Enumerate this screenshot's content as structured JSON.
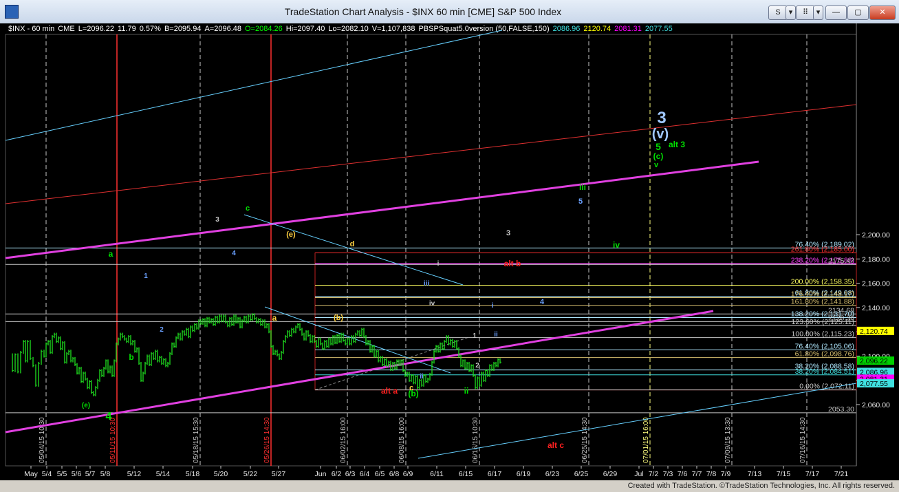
{
  "window": {
    "title": "TradeStation Chart Analysis - $INX 60 min [CME] S&P 500 Index",
    "buttons": [
      "S",
      "▾",
      "⠿",
      "▾",
      "—",
      "▢",
      "✕"
    ]
  },
  "header_line": {
    "items": [
      {
        "text": "$INX - 60 min",
        "color": "#ffffff"
      },
      {
        "text": "CME",
        "color": "#ffffff"
      },
      {
        "text": "L=2096.22",
        "color": "#ffffff"
      },
      {
        "text": "11.79",
        "color": "#ffffff"
      },
      {
        "text": "0.57%",
        "color": "#ffffff"
      },
      {
        "text": "B=2095.94",
        "color": "#ffffff"
      },
      {
        "text": "A=2096.48",
        "color": "#ffffff"
      },
      {
        "text": "O=2084.26",
        "color": "#00ff00"
      },
      {
        "text": "Hi=2097.40",
        "color": "#ffffff"
      },
      {
        "text": "Lo=2082.10",
        "color": "#ffffff"
      },
      {
        "text": "V=1,107,838",
        "color": "#ffffff"
      },
      {
        "text": "PBSPSquat5.0version (50,FALSE,150)",
        "color": "#ffffff"
      },
      {
        "text": "2086.96",
        "color": "#40e0e0"
      },
      {
        "text": "2120.74",
        "color": "#ffff00"
      },
      {
        "text": "2081.31",
        "color": "#ff00ff"
      },
      {
        "text": "2077.55",
        "color": "#40e0e0"
      }
    ]
  },
  "credit": "Created with TradeStation. ©TradeStation Technologies, Inc. All rights reserved.",
  "chart_data": {
    "type": "line",
    "instrument": "$INX 60 min",
    "ylim": [
      2047,
      2206
    ],
    "price_ticks": [
      "2,060.00",
      "2,080.00",
      "2,100.00",
      "2,120.00",
      "2,140.00",
      "2,160.00",
      "2,180.00",
      "2,200.00"
    ],
    "date_ticks": [
      "May",
      "5/4",
      "5/5",
      "5/6",
      "5/7",
      "5/8",
      "5/12",
      "5/14",
      "5/18",
      "5/20",
      "5/22",
      "5/27",
      "Jun",
      "6/2",
      "6/3",
      "6/4",
      "6/5",
      "6/8",
      "6/9",
      "6/11",
      "6/15",
      "6/17",
      "6/19",
      "6/23",
      "6/25",
      "6/29",
      "Jul",
      "7/2",
      "7/3",
      "7/6",
      "7/7",
      "7/8",
      "7/9",
      "7/13",
      "7/15",
      "7/17",
      "7/21"
    ],
    "vertical_date_labels": [
      {
        "text": "05/04/15 10:30",
        "color": "#c8c8c8"
      },
      {
        "text": "05/11/15 10:30",
        "color": "#ff3030"
      },
      {
        "text": "05/18/15 15:30",
        "color": "#c8c8c8"
      },
      {
        "text": "05/26/15 14:30",
        "color": "#ff3030"
      },
      {
        "text": "06/02/15 16:00",
        "color": "#c8c8c8"
      },
      {
        "text": "06/08/15 16:00",
        "color": "#c8c8c8"
      },
      {
        "text": "06/16/15 10:30",
        "color": "#c8c8c8"
      },
      {
        "text": "06/25/15 14:30",
        "color": "#c8c8c8"
      },
      {
        "text": "07/01/15 16:00",
        "color": "#ffff80"
      },
      {
        "text": "07/09/15 13:30",
        "color": "#c8c8c8"
      },
      {
        "text": "07/16/15 14:30",
        "color": "#c8c8c8"
      }
    ],
    "price_series": [
      [
        0,
        2101
      ],
      [
        6,
        2088
      ],
      [
        10,
        2101
      ],
      [
        14,
        2087
      ],
      [
        18,
        2103
      ],
      [
        22,
        2112
      ],
      [
        25,
        2096
      ],
      [
        28,
        2112
      ],
      [
        32,
        2098
      ],
      [
        36,
        2092
      ],
      [
        40,
        2076
      ],
      [
        44,
        2094
      ],
      [
        48,
        2104
      ],
      [
        52,
        2100
      ],
      [
        55,
        2110
      ],
      [
        58,
        2112
      ],
      [
        61,
        2103
      ],
      [
        64,
        2116
      ],
      [
        67,
        2118
      ],
      [
        70,
        2112
      ],
      [
        73,
        2115
      ],
      [
        76,
        2106
      ],
      [
        79,
        2111
      ],
      [
        82,
        2095
      ],
      [
        85,
        2102
      ],
      [
        88,
        2104
      ],
      [
        91,
        2096
      ],
      [
        94,
        2098
      ],
      [
        97,
        2093
      ],
      [
        100,
        2086
      ],
      [
        103,
        2090
      ],
      [
        106,
        2079
      ],
      [
        109,
        2086
      ],
      [
        112,
        2081
      ],
      [
        115,
        2074
      ],
      [
        118,
        2079
      ],
      [
        121,
        2070
      ],
      [
        124,
        2068
      ],
      [
        127,
        2074
      ],
      [
        130,
        2080
      ],
      [
        133,
        2088
      ],
      [
        136,
        2084
      ],
      [
        139,
        2090
      ],
      [
        142,
        2096
      ],
      [
        145,
        2087
      ],
      [
        148,
        2091
      ],
      [
        151,
        2084
      ],
      [
        154,
        2096
      ],
      [
        157,
        2110
      ],
      [
        160,
        2114
      ],
      [
        163,
        2118
      ],
      [
        166,
        2116
      ],
      [
        169,
        2114
      ],
      [
        172,
        2112
      ],
      [
        175,
        2116
      ],
      [
        178,
        2110
      ],
      [
        181,
        2112
      ],
      [
        184,
        2104
      ],
      [
        187,
        2106
      ],
      [
        190,
        2094
      ],
      [
        193,
        2080
      ],
      [
        196,
        2086
      ],
      [
        199,
        2094
      ],
      [
        202,
        2100
      ],
      [
        205,
        2093
      ],
      [
        208,
        2102
      ],
      [
        211,
        2098
      ],
      [
        214,
        2104
      ],
      [
        217,
        2096
      ],
      [
        220,
        2099
      ],
      [
        223,
        2094
      ],
      [
        226,
        2097
      ],
      [
        229,
        2092
      ],
      [
        232,
        2094
      ],
      [
        235,
        2102
      ],
      [
        238,
        2110
      ],
      [
        241,
        2108
      ],
      [
        244,
        2115
      ],
      [
        247,
        2118
      ],
      [
        250,
        2114
      ],
      [
        253,
        2120
      ],
      [
        256,
        2118
      ],
      [
        259,
        2122
      ],
      [
        262,
        2116
      ],
      [
        265,
        2124
      ],
      [
        268,
        2121
      ],
      [
        271,
        2126
      ],
      [
        274,
        2123
      ],
      [
        277,
        2129
      ],
      [
        280,
        2127
      ],
      [
        283,
        2130
      ],
      [
        286,
        2125
      ],
      [
        289,
        2131
      ],
      [
        292,
        2128
      ],
      [
        295,
        2130
      ],
      [
        298,
        2126
      ],
      [
        301,
        2132
      ],
      [
        304,
        2128
      ],
      [
        307,
        2133
      ],
      [
        310,
        2129
      ],
      [
        313,
        2133
      ],
      [
        316,
        2128
      ],
      [
        319,
        2125
      ],
      [
        322,
        2131
      ],
      [
        325,
        2126
      ],
      [
        328,
        2133
      ],
      [
        331,
        2128
      ],
      [
        334,
        2131
      ],
      [
        337,
        2124
      ],
      [
        340,
        2129
      ],
      [
        343,
        2132
      ],
      [
        346,
        2128
      ],
      [
        349,
        2133
      ],
      [
        352,
        2130
      ],
      [
        355,
        2134
      ],
      [
        358,
        2131
      ],
      [
        361,
        2128
      ],
      [
        364,
        2130
      ],
      [
        367,
        2126
      ],
      [
        370,
        2129
      ],
      [
        373,
        2124
      ],
      [
        376,
        2126
      ],
      [
        379,
        2120
      ],
      [
        382,
        2108
      ],
      [
        385,
        2102
      ],
      [
        388,
        2104
      ],
      [
        391,
        2101
      ],
      [
        394,
        2098
      ],
      [
        397,
        2103
      ],
      [
        400,
        2112
      ],
      [
        403,
        2116
      ],
      [
        406,
        2120
      ],
      [
        409,
        2117
      ],
      [
        412,
        2122
      ],
      [
        415,
        2120
      ],
      [
        418,
        2124
      ],
      [
        421,
        2126
      ],
      [
        424,
        2122
      ],
      [
        427,
        2118
      ],
      [
        430,
        2114
      ],
      [
        433,
        2120
      ],
      [
        436,
        2117
      ],
      [
        439,
        2112
      ],
      [
        442,
        2116
      ],
      [
        445,
        2112
      ],
      [
        448,
        2108
      ],
      [
        451,
        2114
      ],
      [
        454,
        2110
      ],
      [
        457,
        2106
      ],
      [
        460,
        2112
      ],
      [
        463,
        2108
      ],
      [
        466,
        2114
      ],
      [
        469,
        2110
      ],
      [
        472,
        2116
      ],
      [
        475,
        2111
      ],
      [
        478,
        2117
      ],
      [
        481,
        2112
      ],
      [
        484,
        2118
      ],
      [
        487,
        2113
      ],
      [
        490,
        2110
      ],
      [
        493,
        2114
      ],
      [
        496,
        2110
      ],
      [
        499,
        2116
      ],
      [
        502,
        2112
      ],
      [
        505,
        2118
      ],
      [
        508,
        2120
      ],
      [
        511,
        2117
      ],
      [
        514,
        2122
      ],
      [
        517,
        2116
      ],
      [
        520,
        2110
      ],
      [
        523,
        2112
      ],
      [
        526,
        2104
      ],
      [
        529,
        2108
      ],
      [
        532,
        2100
      ],
      [
        535,
        2104
      ],
      [
        538,
        2096
      ],
      [
        541,
        2099
      ],
      [
        544,
        2093
      ],
      [
        547,
        2097
      ],
      [
        550,
        2092
      ],
      [
        553,
        2095
      ],
      [
        556,
        2089
      ],
      [
        559,
        2094
      ],
      [
        562,
        2090
      ],
      [
        565,
        2096
      ],
      [
        568,
        2093
      ],
      [
        571,
        2096
      ],
      [
        574,
        2088
      ],
      [
        577,
        2084
      ],
      [
        580,
        2086
      ],
      [
        583,
        2080
      ],
      [
        586,
        2084
      ],
      [
        589,
        2078
      ],
      [
        592,
        2083
      ],
      [
        595,
        2074
      ],
      [
        598,
        2080
      ],
      [
        601,
        2076
      ],
      [
        604,
        2084
      ],
      [
        607,
        2079
      ],
      [
        610,
        2081
      ],
      [
        613,
        2085
      ],
      [
        616,
        2095
      ],
      [
        619,
        2104
      ],
      [
        622,
        2108
      ],
      [
        625,
        2104
      ],
      [
        628,
        2110
      ],
      [
        631,
        2106
      ],
      [
        634,
        2112
      ],
      [
        637,
        2116
      ],
      [
        640,
        2110
      ],
      [
        643,
        2113
      ],
      [
        646,
        2108
      ],
      [
        649,
        2112
      ],
      [
        652,
        2106
      ],
      [
        655,
        2100
      ],
      [
        658,
        2092
      ],
      [
        661,
        2096
      ],
      [
        664,
        2090
      ],
      [
        667,
        2094
      ],
      [
        670,
        2088
      ],
      [
        673,
        2092
      ],
      [
        676,
        2084
      ],
      [
        679,
        2074
      ],
      [
        682,
        2082
      ],
      [
        685,
        2076
      ],
      [
        688,
        2086
      ],
      [
        691,
        2080
      ],
      [
        694,
        2088
      ],
      [
        697,
        2084
      ],
      [
        700,
        2092
      ],
      [
        703,
        2089
      ],
      [
        706,
        2094
      ],
      [
        709,
        2092
      ],
      [
        712,
        2097
      ],
      [
        715,
        2095
      ]
    ],
    "horizontal_levels": [
      {
        "label": "76.40% (2,189.02)",
        "price": 2189.02,
        "color": "#b0e8ff"
      },
      {
        "label": "261.80% (2,185.00)",
        "price": 2185.0,
        "color": "#ff3030"
      },
      {
        "label": "238.20% (2,175.88)",
        "price": 2175.88,
        "color": "#ff40ff"
      },
      {
        "label": "2175.47",
        "price": 2175.47,
        "color": "#c8c8c8"
      },
      {
        "label": "200.00% (2,158.35)",
        "price": 2158.35,
        "color": "#ffff60"
      },
      {
        "label": "61.80% (2,149.08)",
        "price": 2149.08,
        "color": "#b0e8ff"
      },
      {
        "label": "176.40% (2,148.17)",
        "price": 2148.17,
        "color": "#d8c070"
      },
      {
        "label": "161.80% (2,141.88)",
        "price": 2141.88,
        "color": "#d8c070"
      },
      {
        "label": "2134.68",
        "price": 2134.68,
        "color": "#c8c8c8"
      },
      {
        "label": "138.20% (2,131.70)",
        "price": 2131.7,
        "color": "#b0e8ff"
      },
      {
        "label": "2128.36",
        "price": 2128.36,
        "color": "#c8c8c8"
      },
      {
        "label": "123.60% (2,125.11)",
        "price": 2125.11,
        "color": "#c8c8c8"
      },
      {
        "label": "100.00% (2,115.23)",
        "price": 2115.23,
        "color": "#c8c8c8"
      },
      {
        "label": "76.40% (2,105.06)",
        "price": 2105.06,
        "color": "#b0e8ff"
      },
      {
        "label": "61.80% (2,098.76)",
        "price": 2098.76,
        "color": "#d8c070"
      },
      {
        "label": "38.20% (2,088.58)",
        "price": 2088.58,
        "color": "#b0e8ff"
      },
      {
        "label": "38.20% (2,084.51)",
        "price": 2084.51,
        "color": "#40e0e0"
      },
      {
        "label": "0.00% (2,072.11)",
        "price": 2072.11,
        "color": "#c8c8c8"
      },
      {
        "label": "2053.30",
        "price": 2053.3,
        "color": "#c8c8c8"
      }
    ],
    "price_tags": [
      {
        "text": "2,120.74",
        "price": 2120.74,
        "bg": "#ffff00",
        "fg": "#000000"
      },
      {
        "text": "2,096.22",
        "price": 2096.22,
        "bg": "#00d000",
        "fg": "#000000"
      },
      {
        "text": "2,086.96",
        "price": 2086.96,
        "bg": "#40e0e0",
        "fg": "#000000"
      },
      {
        "text": "2,081.31",
        "price": 2081.31,
        "bg": "#ff00ff",
        "fg": "#000000"
      },
      {
        "text": "2,077.55",
        "price": 2077.55,
        "bg": "#40e0e0",
        "fg": "#000000"
      }
    ],
    "annotations": [
      {
        "text": "3",
        "color": "#a0c8ff",
        "size": 24
      },
      {
        "text": "(v)",
        "color": "#a0c8ff",
        "size": 20
      },
      {
        "text": "5",
        "color": "#00e000",
        "size": 14
      },
      {
        "text": "alt 3",
        "color": "#00e000",
        "size": 12
      },
      {
        "text": "(c)",
        "color": "#00e000",
        "size": 12
      },
      {
        "text": "v",
        "color": "#00e000",
        "size": 11
      },
      {
        "text": "iii",
        "color": "#00e000",
        "size": 12
      },
      {
        "text": "5",
        "color": "#6aa0ff",
        "size": 11
      },
      {
        "text": "3",
        "color": "#c8c8c8",
        "size": 11
      },
      {
        "text": "iv",
        "color": "#00e000",
        "size": 12
      },
      {
        "text": "alt b",
        "color": "#ff2020",
        "size": 12
      },
      {
        "text": "4",
        "color": "#6aa0ff",
        "size": 11
      },
      {
        "text": "i",
        "color": "#6aa0ff",
        "size": 10
      },
      {
        "text": "ii",
        "color": "#6aa0ff",
        "size": 10
      },
      {
        "text": "1",
        "color": "#c8c8c8",
        "size": 10
      },
      {
        "text": "2",
        "color": "#c8c8c8",
        "size": 10
      },
      {
        "text": "ii",
        "color": "#00e000",
        "size": 12
      },
      {
        "text": "alt a",
        "color": "#ff2020",
        "size": 12
      },
      {
        "text": "c",
        "color": "#ffd040",
        "size": 11
      },
      {
        "text": "(b)",
        "color": "#00e000",
        "size": 12
      },
      {
        "text": "ii",
        "color": "#6aa0ff",
        "size": 10
      },
      {
        "text": "iii",
        "color": "#6aa0ff",
        "size": 10
      },
      {
        "text": "iv",
        "color": "#c8c8c8",
        "size": 10
      },
      {
        "text": "i",
        "color": "#c8c8c8",
        "size": 10
      },
      {
        "text": "(e)",
        "color": "#ffd040",
        "size": 11
      },
      {
        "text": "d",
        "color": "#ffd040",
        "size": 11
      },
      {
        "text": "(b)",
        "color": "#ffd040",
        "size": 11
      },
      {
        "text": "a",
        "color": "#ffd040",
        "size": 12
      },
      {
        "text": "c",
        "color": "#00e000",
        "size": 11
      },
      {
        "text": "3",
        "color": "#c8c8c8",
        "size": 10
      },
      {
        "text": "4",
        "color": "#6aa0ff",
        "size": 10
      },
      {
        "text": "a",
        "color": "#00e000",
        "size": 12
      },
      {
        "text": "b",
        "color": "#00e000",
        "size": 12
      },
      {
        "text": "1",
        "color": "#6aa0ff",
        "size": 10
      },
      {
        "text": "2",
        "color": "#6aa0ff",
        "size": 10
      },
      {
        "text": "4",
        "color": "#00e000",
        "size": 16
      },
      {
        "text": "(e)",
        "color": "#00e000",
        "size": 10
      },
      {
        "text": "alt c",
        "color": "#ff2020",
        "size": 12
      }
    ]
  }
}
